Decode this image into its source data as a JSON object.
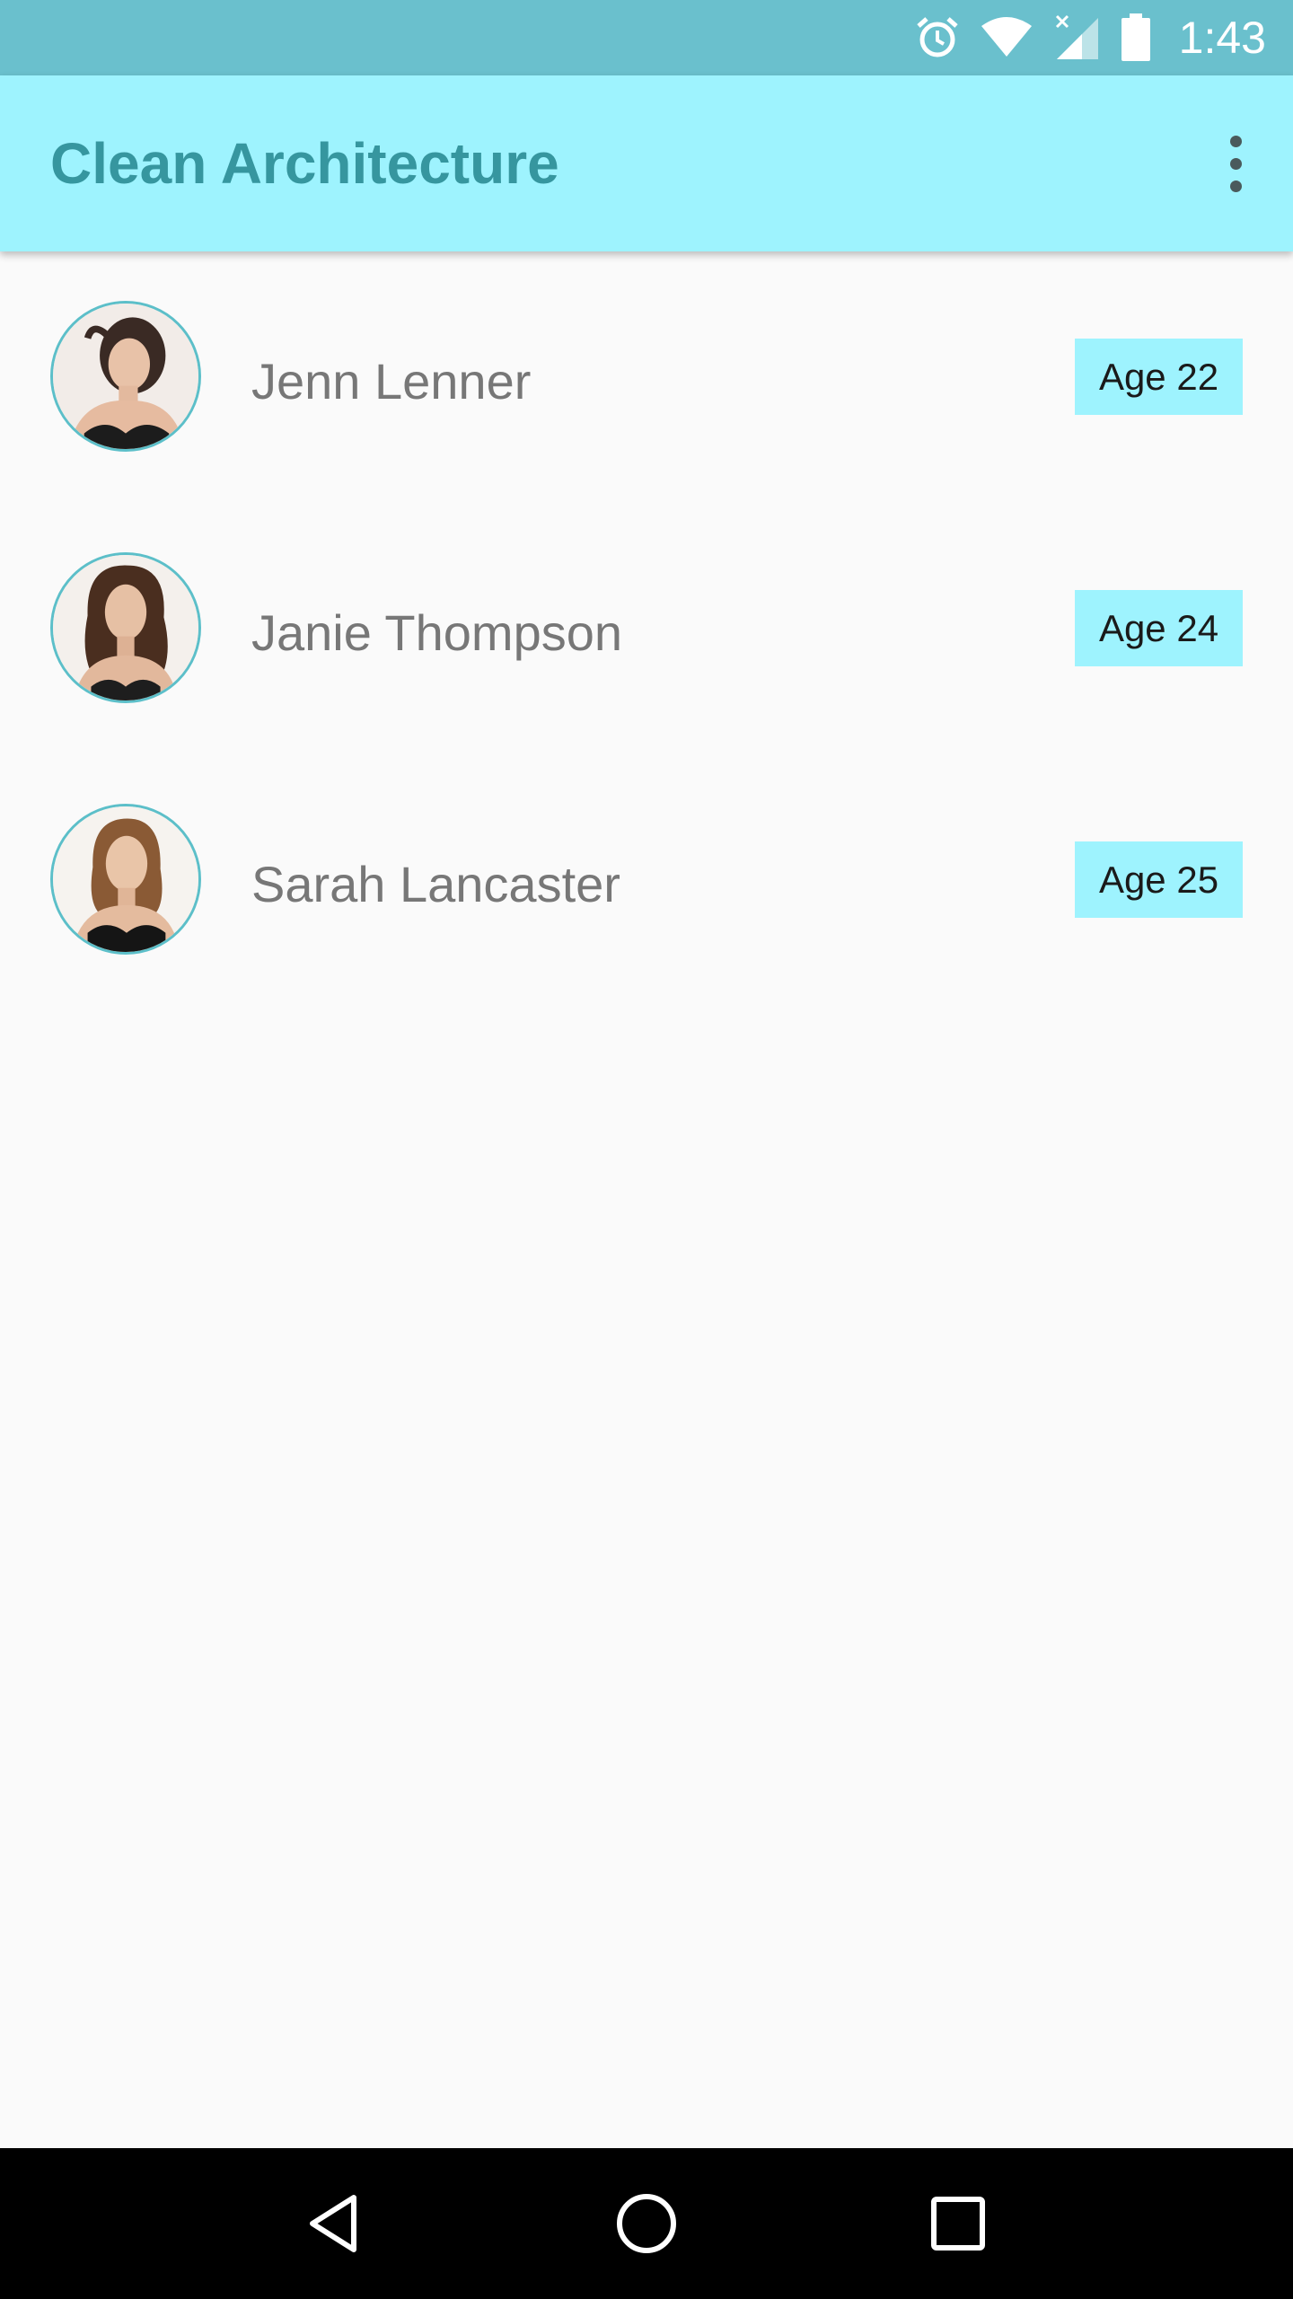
{
  "status_bar": {
    "time": "1:43",
    "icons": [
      "alarm-icon",
      "wifi-icon",
      "signal-no-data-icon",
      "battery-icon"
    ],
    "background": "#6ac0cd"
  },
  "app_bar": {
    "title": "Clean Architecture",
    "overflow_icon": "more-vert-icon",
    "background": "#9ef3fe",
    "title_color": "#36969f"
  },
  "users": [
    {
      "name": "Jenn Lenner",
      "age_label": "Age 22",
      "hair": "#3a2a24"
    },
    {
      "name": "Janie Thompson",
      "age_label": "Age 24",
      "hair": "#4a2e1f"
    },
    {
      "name": "Sarah Lancaster",
      "age_label": "Age 25",
      "hair": "#8a5a35"
    }
  ],
  "nav_bar": {
    "buttons": [
      "back-icon",
      "home-icon",
      "recents-icon"
    ]
  }
}
